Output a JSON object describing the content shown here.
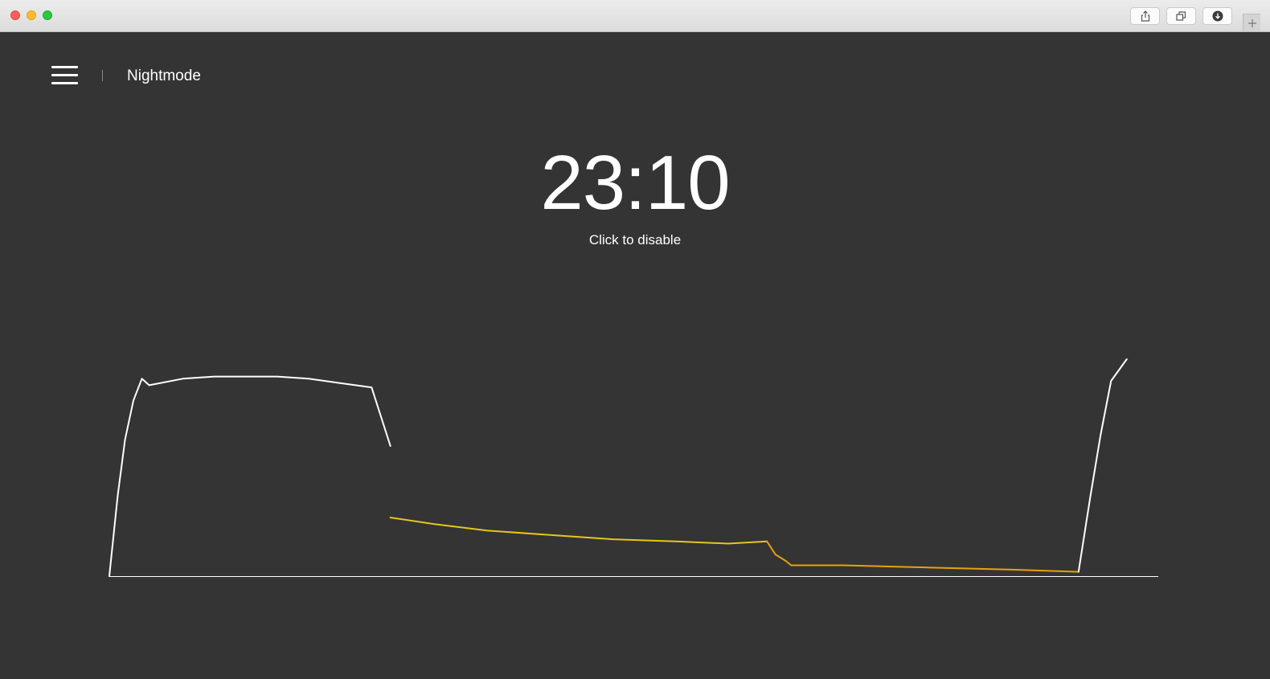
{
  "window": {
    "toolbar_buttons": [
      "share-icon",
      "tabs-icon",
      "download-icon"
    ],
    "new_tab_icon": "plus-icon"
  },
  "header": {
    "menu_icon": "hamburger-menu-icon",
    "title": "Nightmode"
  },
  "clock": {
    "time": "23:10",
    "action_label": "Click to disable"
  },
  "colors": {
    "background": "#343434",
    "text": "#ffffff",
    "day_curve": "#ffffff",
    "evening_curve": "#e7c61c",
    "night_curve": "#e9a10a"
  },
  "chart_data": {
    "type": "line",
    "title": "",
    "xlabel": "",
    "ylabel": "",
    "grid": false,
    "legend": "none",
    "xlim": [
      0,
      100
    ],
    "ylim": [
      0,
      100
    ],
    "series": [
      {
        "color": "#ffffff",
        "x": [
          0,
          0.8,
          1.5,
          2.3,
          3.1,
          3.8,
          7.0,
          10.0,
          13.0,
          16.0,
          19.0,
          22.0,
          25.0,
          26.8
        ],
        "y": [
          0,
          37,
          63,
          81,
          91,
          88,
          91,
          92,
          92,
          92,
          91,
          89,
          87,
          60
        ]
      },
      {
        "color": "#e7c61c",
        "x": [
          26.8,
          31.0,
          36.0,
          42.0,
          48.0,
          54.0,
          59.0,
          62.7
        ],
        "y": [
          27,
          24,
          21,
          19,
          17,
          16,
          15,
          16
        ]
      },
      {
        "color": "#e9a10a",
        "x": [
          62.7,
          63.5,
          64.5,
          65.0,
          70.0,
          78.0,
          86.0,
          92.4
        ],
        "y": [
          16,
          10,
          7,
          5,
          5,
          4,
          3,
          2
        ]
      },
      {
        "color": "#ffffff",
        "x": [
          92.4,
          93.5,
          94.5,
          95.5,
          97.0
        ],
        "y": [
          2,
          36,
          65,
          90,
          100
        ]
      }
    ]
  }
}
